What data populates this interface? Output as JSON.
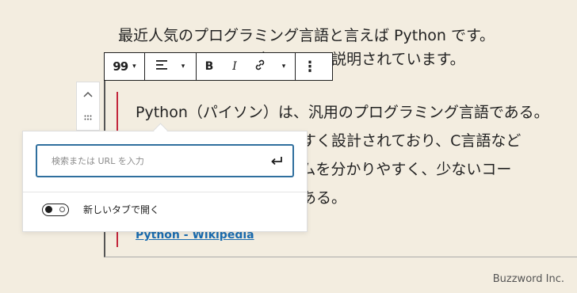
{
  "intro": {
    "line1": "最近人気のプログラミング言語と言えば Python です。",
    "line2": "Wikipedia によると次のように説明されています。"
  },
  "quote": {
    "lines": [
      "Python（パイソン）は、汎用のプログラミング言語である。",
      "　　　　　　　　　いやすく設計されており、C言語など",
      "　　　　　　　　ログラムを分かりやすく、少ないコー",
      "　　　　　　　　特徴がある。"
    ],
    "citation": "Python - Wikipedia"
  },
  "toolbar": {
    "quote_icon": "99",
    "caret": "▾",
    "align_icon": "align-left-icon",
    "bold_label": "B",
    "italic_label": "I",
    "link_icon": "link-icon",
    "more_icon": "⋮"
  },
  "mover": {
    "up_icon": "chevron-up-icon",
    "drag_icon": "drag-handle-icon"
  },
  "link_popover": {
    "url_placeholder": "検索または URL を入力",
    "url_value": "",
    "new_tab_label": "新しいタブで開く",
    "new_tab_enabled": false
  },
  "footer": {
    "brand": "Buzzword Inc."
  },
  "colors": {
    "background": "#f3ede0",
    "quote_bar": "#c3263b",
    "link": "#1a6cb0",
    "focus": "#2f6f9e"
  }
}
